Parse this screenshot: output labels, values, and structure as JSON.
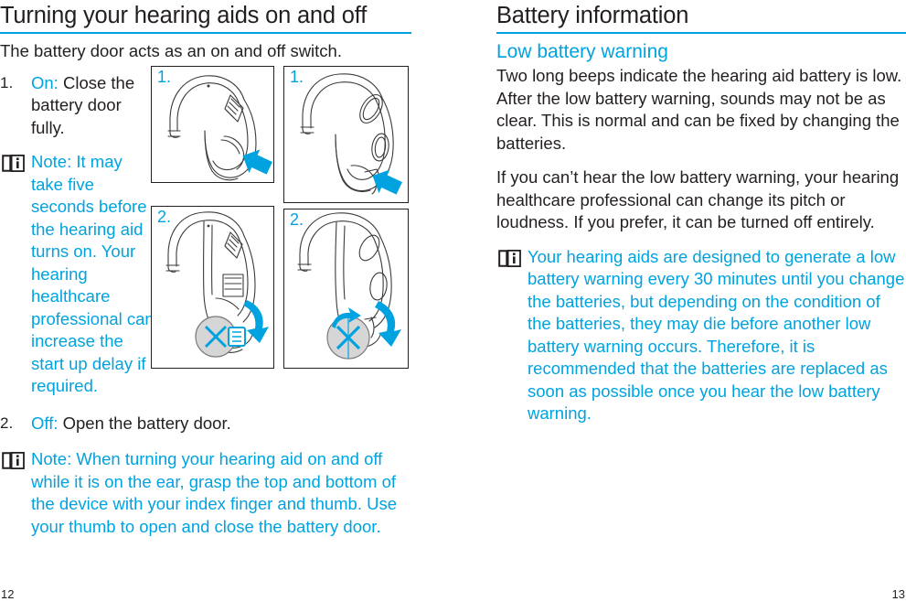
{
  "theme": {
    "accent": "#00a3e0",
    "text": "#231f20",
    "background": "#ffffff"
  },
  "left_column": {
    "heading": "Turning your hearing aids on and off",
    "intro": "The battery door acts as an on and off switch.",
    "steps": [
      {
        "number": "1.",
        "lead": "On:",
        "text": " Close the battery door fully."
      },
      {
        "number": "2.",
        "lead": "Off:",
        "text": " Open the battery door."
      }
    ],
    "note_1": {
      "icon": "consult-instructions-icon",
      "text": "Note: It may take five seconds before the hearing aid turns on. Your hearing healthcare professional can increase the start up delay if required."
    },
    "note_2": {
      "icon": "consult-instructions-icon",
      "text": "Note: When turning your hearing aid on and off while it is on the ear, grasp the top and bottom of the device with your index finger and thumb. Use your thumb to open and close the battery door."
    },
    "figures": [
      {
        "label": "1.",
        "caption": "bte-hearing-aid-closing-battery-door-model-a"
      },
      {
        "label": "1.",
        "caption": "bte-hearing-aid-closing-battery-door-model-b"
      },
      {
        "label": "2.",
        "caption": "bte-hearing-aid-opening-battery-door-model-a"
      },
      {
        "label": "2.",
        "caption": "bte-hearing-aid-opening-battery-door-model-b"
      }
    ]
  },
  "right_column": {
    "heading": "Battery information",
    "subheading": "Low battery warning",
    "paragraphs": [
      "Two long beeps indicate the hearing aid battery is low. After the low battery warning, sounds may not be as clear. This is normal and can be fixed by changing the batteries.",
      "If you can’t hear the low battery warning, your hearing healthcare professional can change its pitch or loudness. If you prefer, it can be turned off entirely."
    ],
    "note": {
      "icon": "consult-instructions-icon",
      "text": "Your hearing aids are designed to generate a low battery warning every 30 minutes until you change the batteries, but depending on the condition of the batteries, they may die before another low battery warning occurs. Therefore, it is recommended that the batteries are replaced as soon as possible once you hear the low battery warning."
    }
  },
  "footer": {
    "page_left": "12",
    "page_right": "13"
  }
}
